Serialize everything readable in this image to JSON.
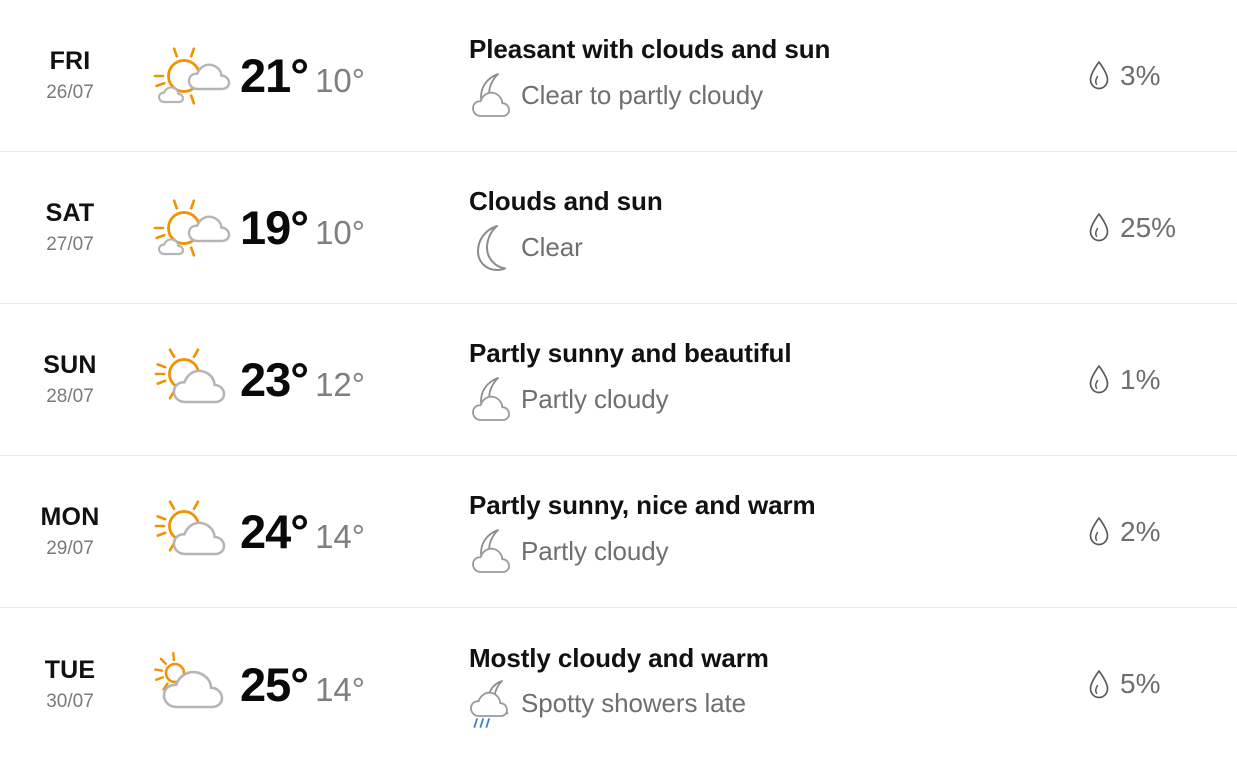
{
  "accent_colors": {
    "sun": "#F29200",
    "cloud": "#B5B5B5",
    "rain": "#3F7FD1",
    "text_primary": "#111111",
    "text_secondary": "#6F6F6F",
    "divider": "#E8E8EE",
    "background": "#FFFFFF"
  },
  "forecast": {
    "rows": [
      {
        "day": "FRI",
        "date": "26/07",
        "day_icon": "sun-cloud-icon",
        "high": "21°",
        "low": "10°",
        "day_desc": "Pleasant with clouds and sun",
        "night_icon": "moon-cloud-icon",
        "night_desc": "Clear to partly cloudy",
        "precip_icon": "droplet-icon",
        "precip": "3%"
      },
      {
        "day": "SAT",
        "date": "27/07",
        "day_icon": "sun-cloud-icon",
        "high": "19°",
        "low": "10°",
        "day_desc": "Clouds and sun",
        "night_icon": "moon-icon",
        "night_desc": "Clear",
        "precip_icon": "droplet-icon",
        "precip": "25%"
      },
      {
        "day": "SUN",
        "date": "28/07",
        "day_icon": "sun-behind-cloud-icon",
        "high": "23°",
        "low": "12°",
        "day_desc": "Partly sunny and beautiful",
        "night_icon": "moon-cloud-icon",
        "night_desc": "Partly cloudy",
        "precip_icon": "droplet-icon",
        "precip": "1%"
      },
      {
        "day": "MON",
        "date": "29/07",
        "day_icon": "sun-behind-cloud-icon",
        "high": "24°",
        "low": "14°",
        "day_desc": "Partly sunny, nice and warm",
        "night_icon": "moon-cloud-icon",
        "night_desc": "Partly cloudy",
        "precip_icon": "droplet-icon",
        "precip": "2%"
      },
      {
        "day": "TUE",
        "date": "30/07",
        "day_icon": "mostly-cloudy-sun-icon",
        "high": "25°",
        "low": "14°",
        "day_desc": "Mostly cloudy and warm",
        "night_icon": "moon-cloud-rain-icon",
        "night_desc": "Spotty showers late",
        "precip_icon": "droplet-icon",
        "precip": "5%"
      }
    ]
  }
}
